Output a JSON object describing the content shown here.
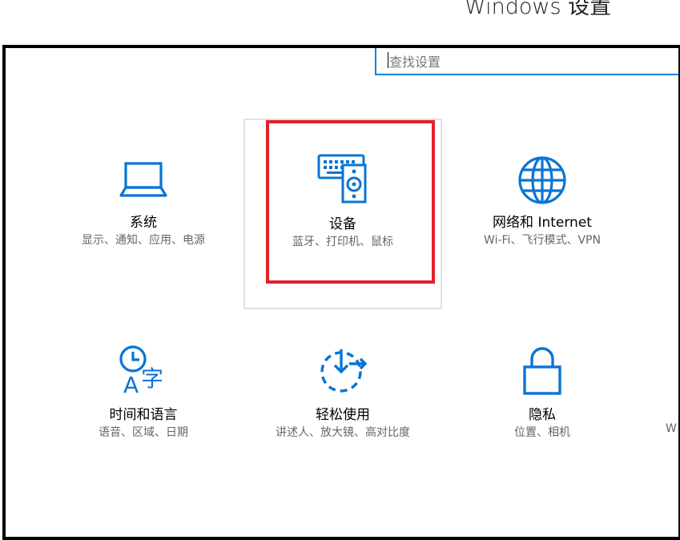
{
  "window": {
    "title": "Windows 设置"
  },
  "search": {
    "placeholder": "查找设置"
  },
  "tiles": [
    {
      "title": "系统",
      "subtitle": "显示、通知、应用、电源",
      "icon": "laptop-icon"
    },
    {
      "title": "设备",
      "subtitle": "蓝牙、打印机、鼠标",
      "icon": "devices-icon"
    },
    {
      "title": "网络和 Internet",
      "subtitle": "Wi-Fi、飞行模式、VPN",
      "icon": "globe-icon"
    },
    {
      "title": "时间和语言",
      "subtitle": "语音、区域、日期",
      "icon": "time-language-icon"
    },
    {
      "title": "轻松使用",
      "subtitle": "讲述人、放大镜、高对比度",
      "icon": "ease-of-access-icon"
    },
    {
      "title": "隐私",
      "subtitle": "位置、相机",
      "icon": "lock-icon"
    }
  ],
  "clipped_next_tile": {
    "subtitle_fragment": "W"
  },
  "colors": {
    "accent": "#0a74d6",
    "highlight": "#e0222b",
    "hover_border": "#e2e2e2"
  }
}
